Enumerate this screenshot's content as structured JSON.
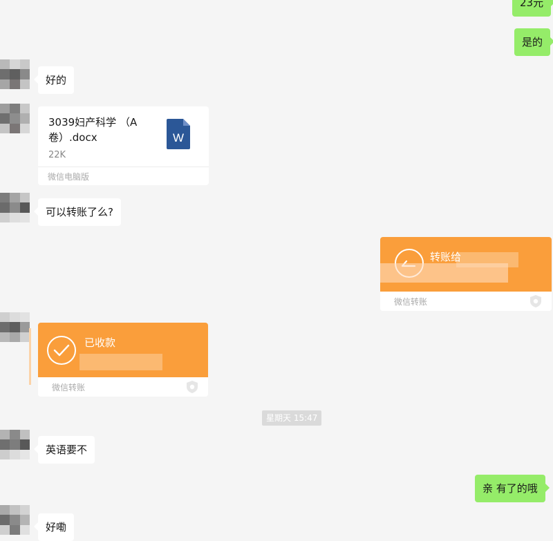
{
  "messages": {
    "top_partial": "23元",
    "yes": "是的",
    "ok1": "好的",
    "can_transfer": "可以转账了么?",
    "english": "英语要不",
    "have_it": "亲 有了的哦",
    "ok2": "好嘞"
  },
  "file": {
    "name": "3039妇产科学 （A卷）.docx",
    "size": "22K",
    "source": "微信电脑版"
  },
  "transfer_out": {
    "title": "转账给",
    "source": "微信转账"
  },
  "transfer_in": {
    "title": "已收款",
    "source": "微信转账"
  },
  "timestamp": "星期天 15:47",
  "colors": {
    "background": "#f5f5f5",
    "bubble_out": "#95ec69",
    "bubble_in": "#ffffff",
    "transfer": "#fa9e3b"
  }
}
